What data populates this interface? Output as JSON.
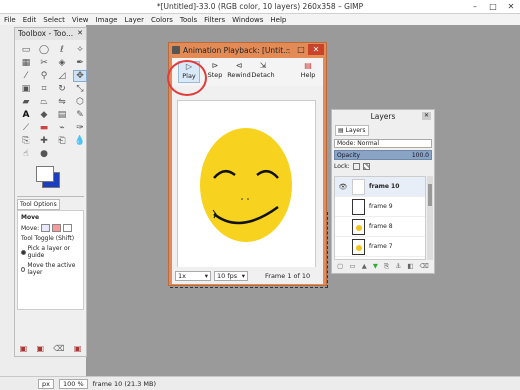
{
  "window": {
    "title": "*[Untitled]-33.0 (RGB color, 10 layers) 260x358 – GIMP",
    "controls": [
      "–",
      "□",
      "✕"
    ]
  },
  "menu": [
    "File",
    "Edit",
    "Select",
    "View",
    "Image",
    "Layer",
    "Colors",
    "Tools",
    "Filters",
    "Windows",
    "Help"
  ],
  "toolbox": {
    "title": "Toolbox - Too...",
    "close": "✕",
    "tool_options_tab": "Tool Options",
    "options": {
      "heading": "Move",
      "move_label": "Move:",
      "toggle_label": "Tool Toggle  (Shift)",
      "opt1": "Pick a layer or guide",
      "opt2": "Move the active layer"
    }
  },
  "animation": {
    "title": "Animation Playback: [Untit...",
    "toolbar": {
      "play": "Play",
      "step": "Step",
      "rewind": "Rewind",
      "detach": "Detach",
      "help": "Help"
    },
    "zoom": "1x",
    "fps": "10 fps",
    "frame_label": "Frame 1 of 10"
  },
  "layers": {
    "title": "Layers",
    "tab": "Layers",
    "mode_label": "Mode:",
    "mode_value": "Normal",
    "opacity_label": "Opacity",
    "opacity_value": "100.0",
    "lock_label": "Lock:",
    "items": [
      {
        "name": "frame 10",
        "selected": true
      },
      {
        "name": "frame 9",
        "selected": false
      },
      {
        "name": "frame 8",
        "selected": false
      },
      {
        "name": "frame 7",
        "selected": false
      }
    ]
  },
  "status": {
    "unit": "px",
    "zoom": "100 %",
    "info": "frame 10 (21.3 MB)"
  },
  "colors": {
    "accent_dialog": "#e38b57",
    "face": "#f7d31f",
    "highlight": "#e23b3b"
  }
}
